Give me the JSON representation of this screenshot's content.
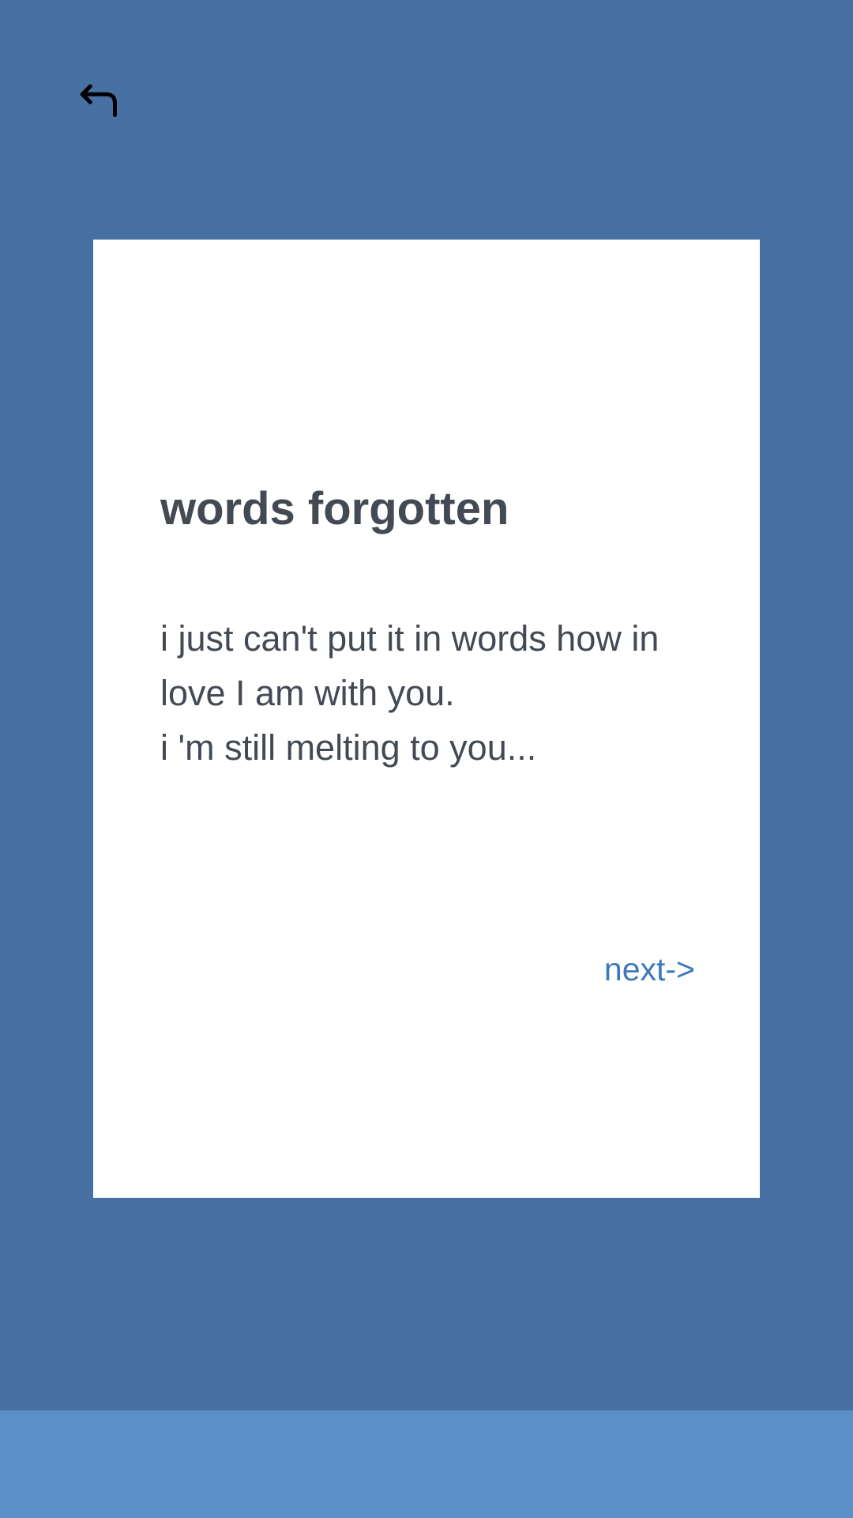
{
  "header": {
    "back_icon": "return-arrow-icon"
  },
  "card": {
    "title": "words forgotten",
    "body_lines": [
      "i just can't put it in words how in love I am with you.",
      "i 'm still melting to you..."
    ],
    "next_label": "next->"
  },
  "colors": {
    "background": "#4770a3",
    "card": "#ffffff",
    "title_text": "#434a54",
    "link": "#3f78bb",
    "bottom_bar": "#5b8fc8"
  }
}
